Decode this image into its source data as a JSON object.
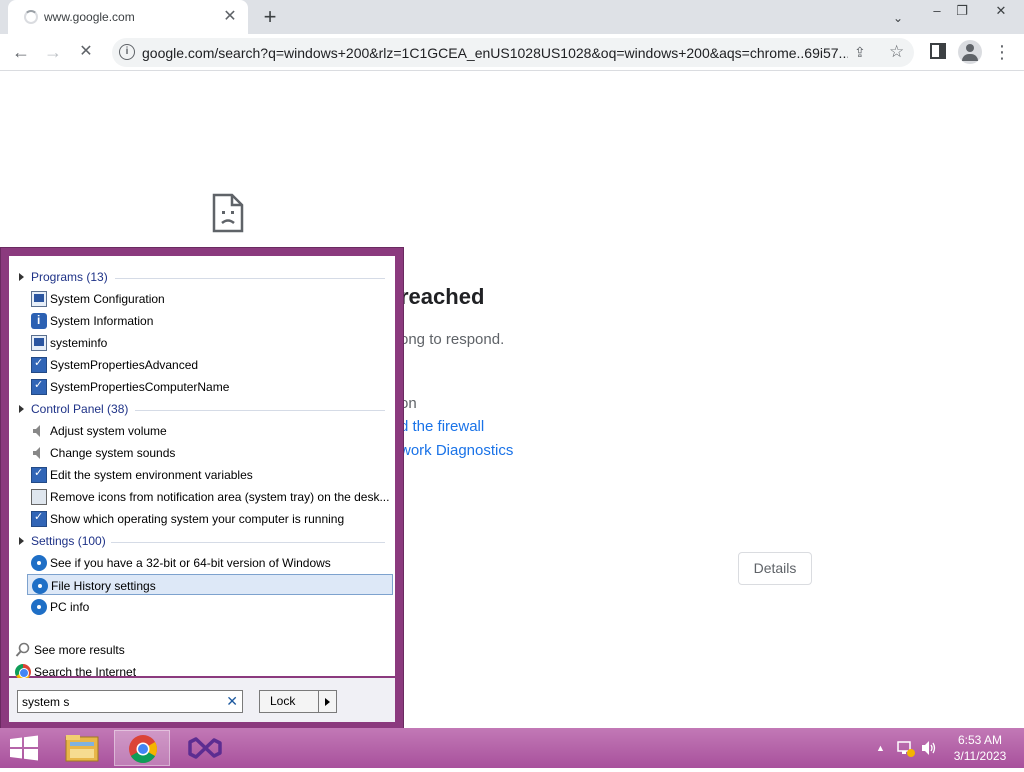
{
  "browser": {
    "tab_title": "www.google.com",
    "tab_close": "✕",
    "new_tab": "+",
    "tab_search": "⌄",
    "win_minimize": "–",
    "win_restore": "❐",
    "win_close": "✕",
    "back": "←",
    "forward": "→",
    "reload": "✕",
    "url": "google.com/search?q=windows+200&rlz=1C1GCEA_enUS1028US1028&oq=windows+200&aqs=chrome..69i57....",
    "info_icon": "i",
    "share_icon": "⇪",
    "star_icon": "☆",
    "menu": "⋮"
  },
  "error_page": {
    "heading": "reached",
    "line1": "ong to respond.",
    "line2": "on",
    "link1": "d the firewall",
    "link2": "work Diagnostics",
    "details_button": "Details"
  },
  "start_menu": {
    "categories": [
      {
        "label": "Programs (13)"
      },
      {
        "label": "Control Panel (38)"
      },
      {
        "label": "Settings (100)"
      }
    ],
    "programs": [
      {
        "label": "System Configuration",
        "icon": "msconfig-icon"
      },
      {
        "label": "System Information",
        "icon": "sysinfo-icon"
      },
      {
        "label": "systeminfo",
        "icon": "console-icon"
      },
      {
        "label": "SystemPropertiesAdvanced",
        "icon": "sysprops-icon"
      },
      {
        "label": "SystemPropertiesComputerName",
        "icon": "sysprops-icon"
      }
    ],
    "control_panel": [
      {
        "label": "Adjust system volume",
        "icon": "speaker-icon"
      },
      {
        "label": "Change system sounds",
        "icon": "speaker-icon"
      },
      {
        "label": "Edit the system environment variables",
        "icon": "sysprops-icon"
      },
      {
        "label": "Remove icons from notification area (system tray) on the desk...",
        "icon": "laptop-icon"
      },
      {
        "label": "Show which operating system your computer is running",
        "icon": "sysprops-icon"
      }
    ],
    "settings": [
      {
        "label": "See if you have a 32-bit or 64-bit version of Windows",
        "icon": "gear-icon"
      },
      {
        "label": "File History settings",
        "icon": "gear-icon",
        "selected": true
      },
      {
        "label": "PC info",
        "icon": "gear-icon"
      }
    ],
    "see_more": "See more results",
    "search_internet": "Search the Internet",
    "search_value": "system s",
    "clear_icon": "✕",
    "lock_label": "Lock"
  },
  "taskbar": {
    "apps": [
      "file-explorer-icon",
      "chrome-icon",
      "visual-studio-icon"
    ],
    "tray_arrow": "▲",
    "time": "6:53 AM",
    "date": "3/11/2023"
  },
  "colors": {
    "taskbar": "#b15aa5",
    "start_menu_frame": "#8b3a7e",
    "selection": "#dde8f7",
    "link": "#1a73e8"
  }
}
